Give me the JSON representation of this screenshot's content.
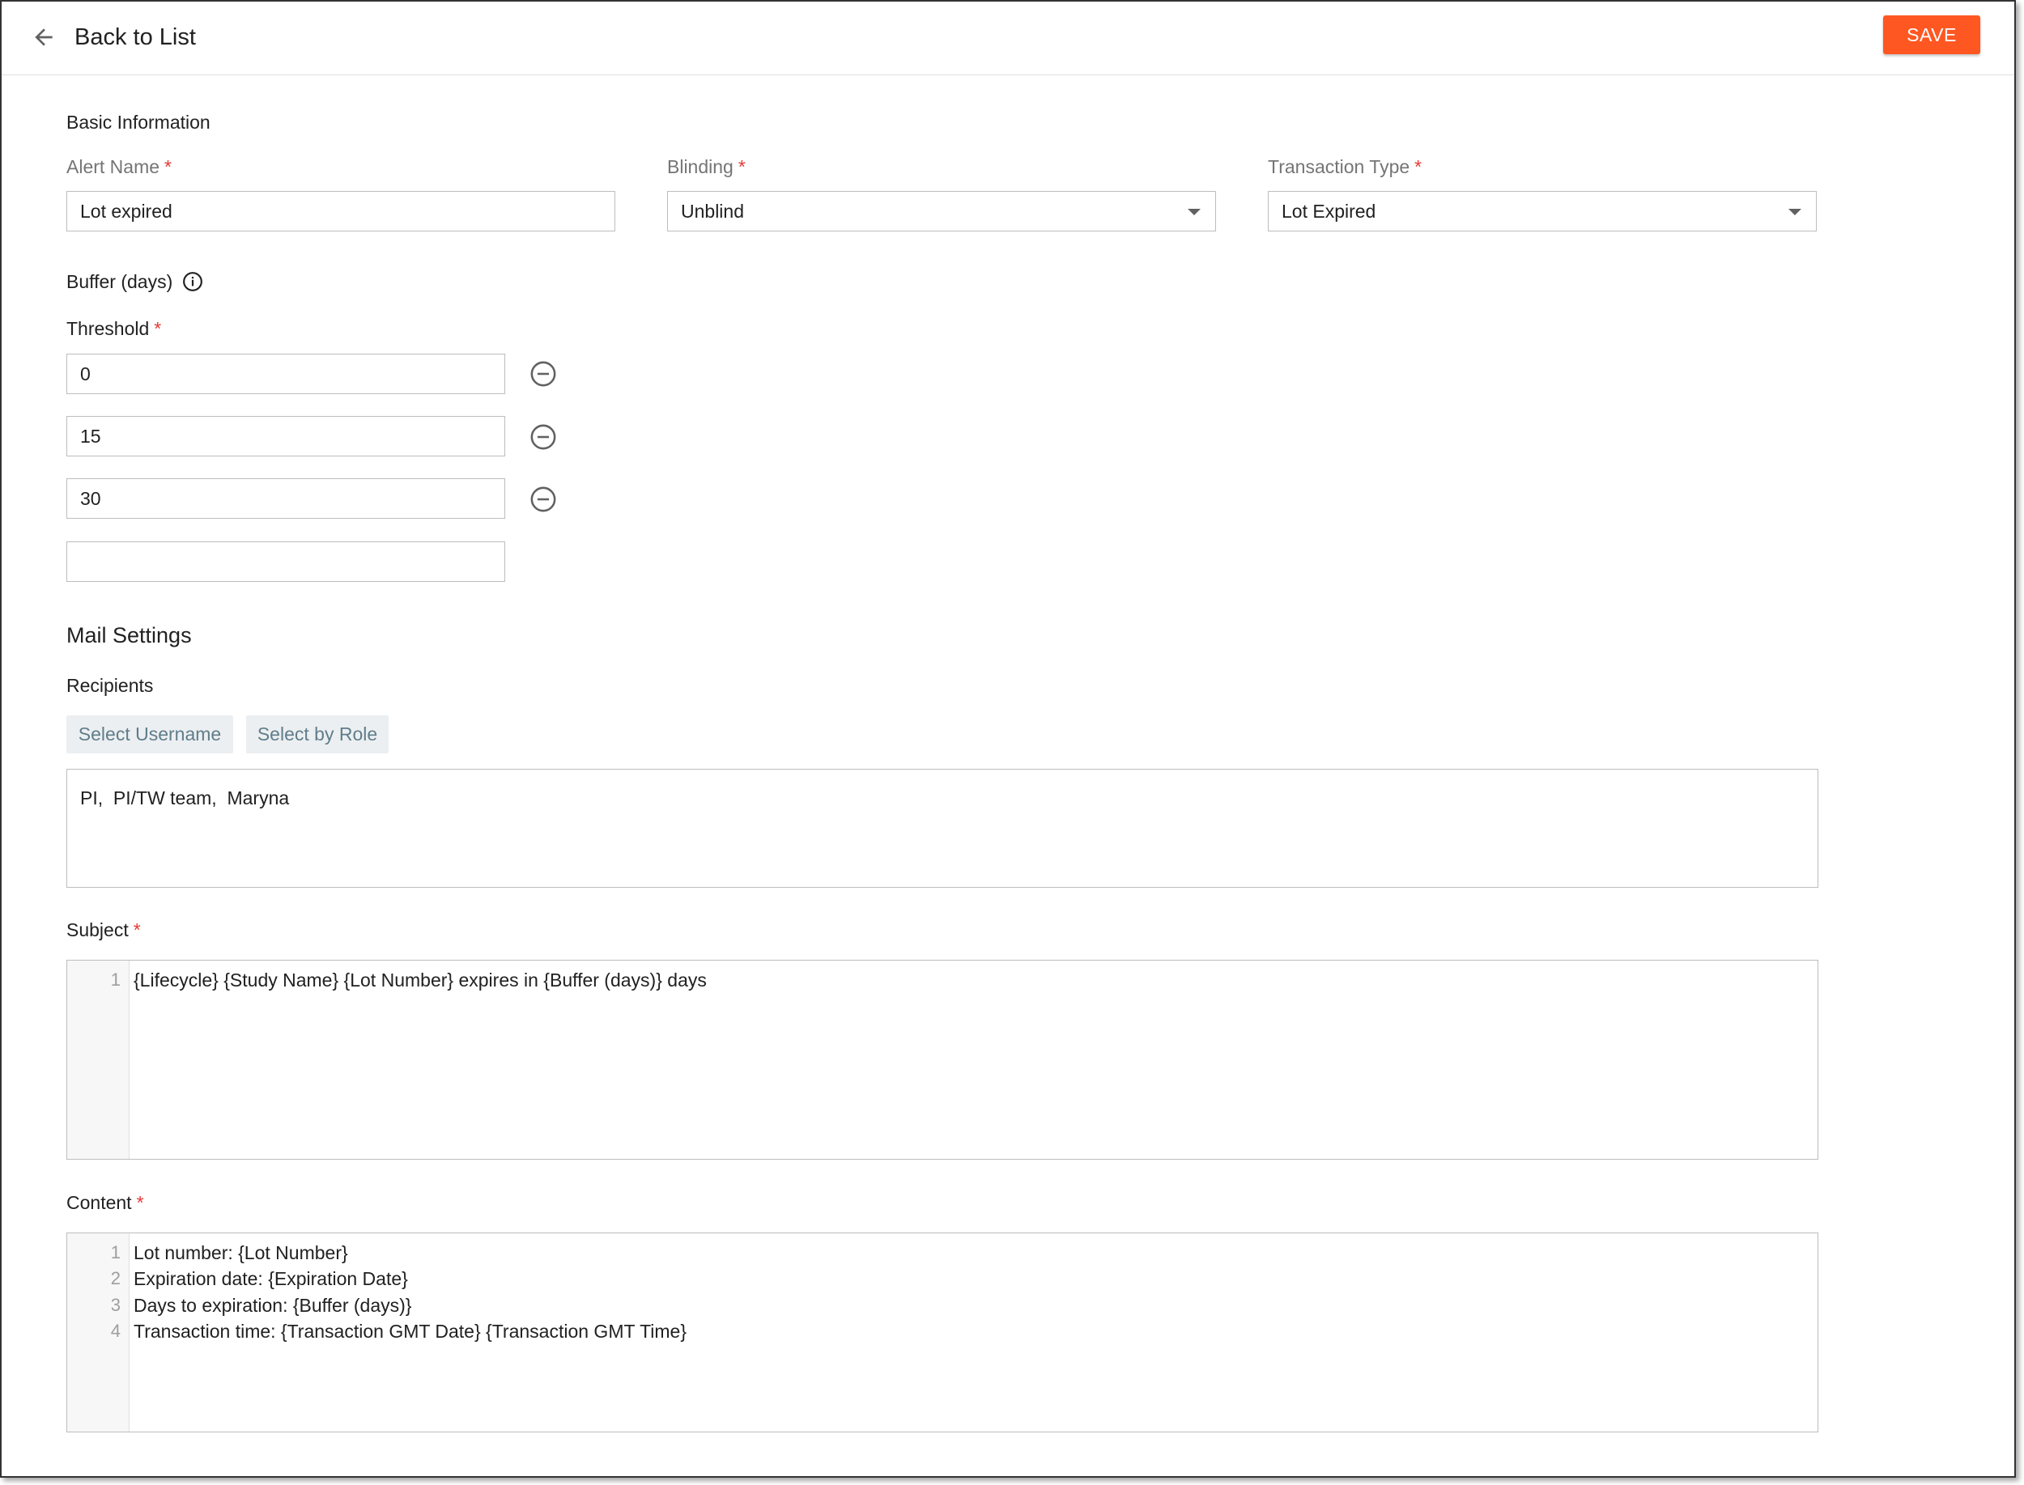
{
  "header": {
    "back_label": "Back to List",
    "save_label": "SAVE"
  },
  "basic": {
    "title": "Basic Information",
    "alert_name": {
      "label": "Alert Name",
      "value": "Lot expired"
    },
    "blinding": {
      "label": "Blinding",
      "value": "Unblind"
    },
    "transaction_type": {
      "label": "Transaction Type",
      "value": "Lot Expired"
    },
    "buffer_label": "Buffer (days)",
    "threshold_label": "Threshold",
    "thresholds": [
      "0",
      "15",
      "30",
      ""
    ]
  },
  "mail": {
    "title": "Mail Settings",
    "recipients_label": "Recipients",
    "select_username": "Select Username",
    "select_by_role": "Select by Role",
    "recipients_value": "PI,  PI/TW team,  Maryna",
    "subject_label": "Subject",
    "subject_lines": [
      {
        "n": "1",
        "text": "{Lifecycle} {Study Name} {Lot Number} expires in {Buffer (days)} days"
      }
    ],
    "content_label": "Content",
    "content_lines": [
      {
        "n": "1",
        "text": "Lot number: {Lot Number}"
      },
      {
        "n": "2",
        "text": "Expiration date: {Expiration Date}"
      },
      {
        "n": "3",
        "text": "Days to expiration: {Buffer (days)}"
      },
      {
        "n": "4",
        "text": "Transaction time: {Transaction GMT Date} {Transaction GMT Time}"
      }
    ]
  },
  "required_mark": "*",
  "colors": {
    "accent": "#ff5722",
    "required": "#e53935",
    "chip_text": "#607d8b"
  }
}
